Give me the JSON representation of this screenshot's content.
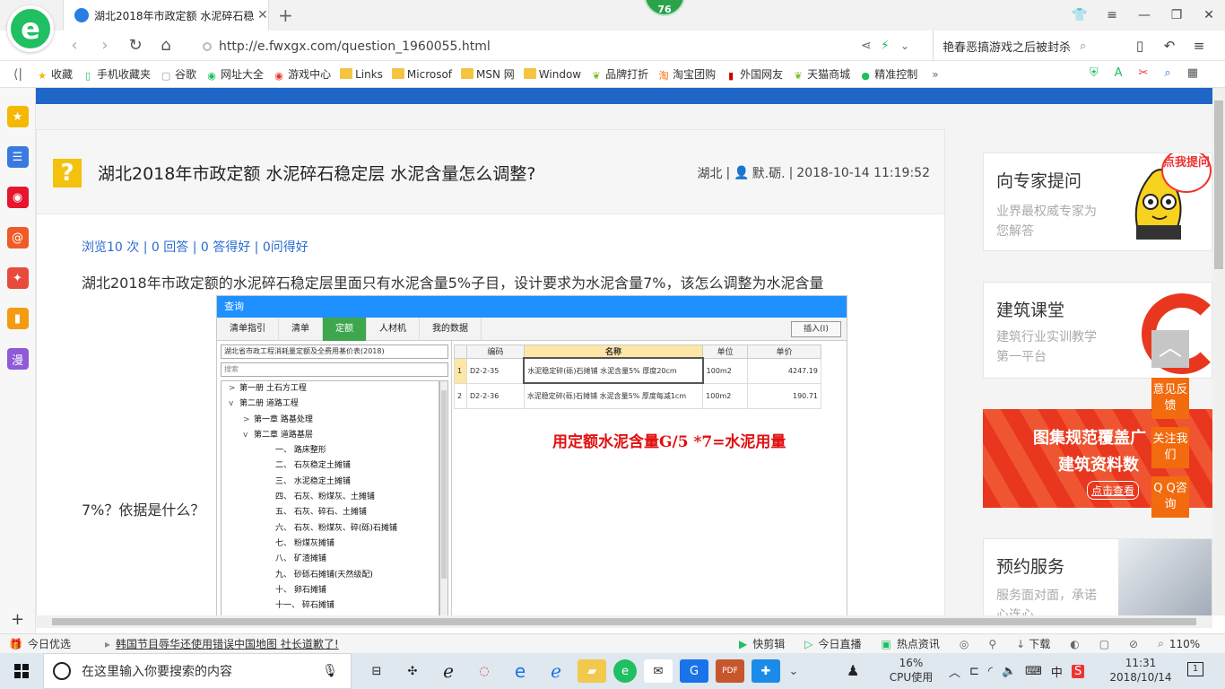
{
  "browser": {
    "logo_letter": "e",
    "tab_title": "湖北2018年市政定额 水泥碎石稳",
    "tab_close": "✕",
    "new_tab": "+",
    "badge": "76",
    "url": "http://e.fwxgx.com/question_1960055.html",
    "hot_search": "艳春恶搞游戏之后被封杀"
  },
  "bookmarks": [
    {
      "label": "收藏",
      "icon": "star-icon"
    },
    {
      "label": "手机收藏夹",
      "icon": "phone-icon"
    },
    {
      "label": "谷歌",
      "icon": "page-icon"
    },
    {
      "label": "网址大全",
      "icon": "globe-icon"
    },
    {
      "label": "游戏中心",
      "icon": "game-icon"
    },
    {
      "label": "Links",
      "icon": "folder-icon"
    },
    {
      "label": "Microsof",
      "icon": "folder-icon"
    },
    {
      "label": "MSN 网",
      "icon": "folder-icon"
    },
    {
      "label": "Window",
      "icon": "folder-icon"
    },
    {
      "label": "品牌打折",
      "icon": "leaf-icon"
    },
    {
      "label": "淘宝团购",
      "icon": "taobao-icon"
    },
    {
      "label": "外国网友",
      "icon": "flag-icon"
    },
    {
      "label": "天猫商城",
      "icon": "leaf-icon"
    },
    {
      "label": "精准控制",
      "icon": "chat-icon"
    }
  ],
  "bookmarks_more": "»",
  "sidebar_icons": [
    {
      "name": "favorites-icon",
      "color": "#f5b800",
      "glyph": "★"
    },
    {
      "name": "feed-icon",
      "color": "#3a7ae0",
      "glyph": "☰"
    },
    {
      "name": "weibo-icon",
      "color": "#e6162d",
      "glyph": "◉"
    },
    {
      "name": "mail-icon",
      "color": "#f05a28",
      "glyph": "@"
    },
    {
      "name": "games-icon",
      "color": "#e84b3c",
      "glyph": "✦"
    },
    {
      "name": "notes-icon",
      "color": "#f39c12",
      "glyph": "▮"
    },
    {
      "name": "comic-icon",
      "color": "#8e5ad6",
      "glyph": "漫"
    }
  ],
  "sidebar_add": "+",
  "question": {
    "mark": "?",
    "title": "湖北2018年市政定额 水泥碎石稳定层 水泥含量怎么调整?",
    "region": "湖北",
    "author": "默.砺.",
    "datetime": "2018-10-14 11:19:52",
    "stats": "浏览10 次 | 0 回答 | 0 答得好 | 0问得好",
    "body": "湖北2018年市政定额的水泥碎石稳定层里面只有水泥含量5%子目，设计要求为水泥含量7%，该怎么调整为水泥含量",
    "body_tail": "7%？依据是什么？"
  },
  "screenshot": {
    "title": "查询",
    "tabs": [
      "清单指引",
      "清单",
      "定额",
      "人材机",
      "我的数据"
    ],
    "active_tab": 2,
    "insert_button": "插入(I)",
    "library": "湖北省市政工程消耗量定额及全费用基价表(2018)",
    "search_placeholder": "搜索",
    "tree": [
      {
        "text": "第一册 土石方工程",
        "level": 0,
        "arrow": ">"
      },
      {
        "text": "第二册 道路工程",
        "level": 0,
        "arrow": "v"
      },
      {
        "text": "第一章 路基处理",
        "level": 1,
        "arrow": ">"
      },
      {
        "text": "第二章 道路基层",
        "level": 1,
        "arrow": "v"
      },
      {
        "text": "一、 路床整形",
        "level": 2,
        "arrow": ""
      },
      {
        "text": "二、 石灰稳定土摊铺",
        "level": 2,
        "arrow": ""
      },
      {
        "text": "三、 水泥稳定土摊铺",
        "level": 2,
        "arrow": ""
      },
      {
        "text": "四、 石灰、粉煤灰、土摊铺",
        "level": 2,
        "arrow": ""
      },
      {
        "text": "五、 石灰、碎石、土摊铺",
        "level": 2,
        "arrow": ""
      },
      {
        "text": "六、 石灰、粉煤灰、碎(砾)石摊铺",
        "level": 2,
        "arrow": ""
      },
      {
        "text": "七、 粉煤灰摊铺",
        "level": 2,
        "arrow": ""
      },
      {
        "text": "八、 矿渣摊铺",
        "level": 2,
        "arrow": ""
      },
      {
        "text": "九、 砂砾石摊铺(天然级配)",
        "level": 2,
        "arrow": ""
      },
      {
        "text": "十、 卵石摊铺",
        "level": 2,
        "arrow": ""
      },
      {
        "text": "十一、 碎石摊铺",
        "level": 2,
        "arrow": ""
      }
    ],
    "columns": [
      "",
      "编码",
      "名称",
      "单位",
      "单价"
    ],
    "rows": [
      {
        "idx": "1",
        "code": "D2-2-35",
        "name": "水泥稳定碎(砾)石摊铺 水泥含量5% 厚度20cm",
        "unit": "100m2",
        "price": "4247.19"
      },
      {
        "idx": "2",
        "code": "D2-2-36",
        "name": "水泥稳定碎(砾)石摊铺 水泥含量5% 厚度每减1cm",
        "unit": "100m2",
        "price": "190.71"
      }
    ],
    "annotation": "用定额水泥含量G/5 *7=水泥用量"
  },
  "right": {
    "expert": {
      "title": "向专家提问",
      "sub": "业界最权威专家为您解答",
      "bubble": "点我提问"
    },
    "classroom": {
      "title": "建筑课堂",
      "sub": "建筑行业实训教学第一平台"
    },
    "banner": {
      "line1": "图集规范覆盖广",
      "line2": "建筑资料数",
      "link": "点击查看"
    },
    "booking": {
      "title": "预约服务",
      "sub": "服务面对面，承诺心连心"
    }
  },
  "floating": {
    "top_arrow": "︿",
    "feedback": "意见反馈",
    "follow": "关注我们",
    "qq": "Q Q咨询"
  },
  "statusbar": {
    "today": "今日优选",
    "news": "韩国节目辱华还使用错误中国地图 社长道歉了!",
    "quickcut": "快剪辑",
    "live": "今日直播",
    "hot": "热点资讯",
    "download": "下载",
    "zoom": "110%"
  },
  "taskbar": {
    "search_placeholder": "在这里输入你要搜索的内容",
    "cpu_percent": "16%",
    "cpu_label": "CPU使用",
    "ime": "中",
    "time": "11:31",
    "date": "2018/10/14",
    "notifications": "1"
  }
}
